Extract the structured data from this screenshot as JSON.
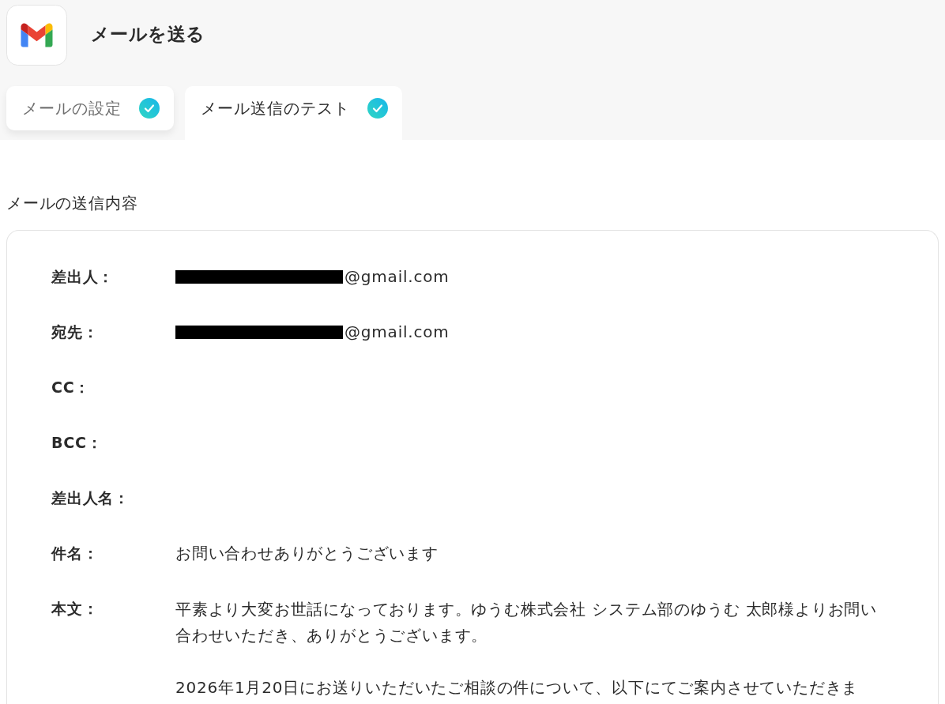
{
  "header": {
    "title": "メールを送る"
  },
  "tabs": [
    {
      "label": "メールの設定",
      "selected": false,
      "done": true
    },
    {
      "label": "メール送信のテスト",
      "selected": true,
      "done": true
    }
  ],
  "section": {
    "title": "メールの送信内容"
  },
  "fields": [
    {
      "kind": "text",
      "label": "差出人：",
      "redacted": true,
      "value": "@gmail.com"
    },
    {
      "kind": "text",
      "label": "宛先：",
      "redacted": true,
      "value": "@gmail.com"
    },
    {
      "kind": "text",
      "label": "CC：",
      "redacted": false
    },
    {
      "kind": "text",
      "label": "BCC：",
      "redacted": false
    },
    {
      "kind": "text",
      "label": "差出人名：",
      "redacted": false
    },
    {
      "kind": "text",
      "label": "件名：",
      "redacted": false,
      "value": "お問い合わせありがとうございます"
    },
    {
      "kind": "multiline",
      "label": "本文：",
      "redacted": false,
      "paragraphs": [
        "平素より大変お世話になっております。ゆうむ株式会社 システム部のゆうむ 太郎様よりお問い合わせいただき、ありがとうございます。",
        "2026年1月20日にお送りいただいたご相談の件について、以下にてご案内させていただきま"
      ]
    }
  ]
}
